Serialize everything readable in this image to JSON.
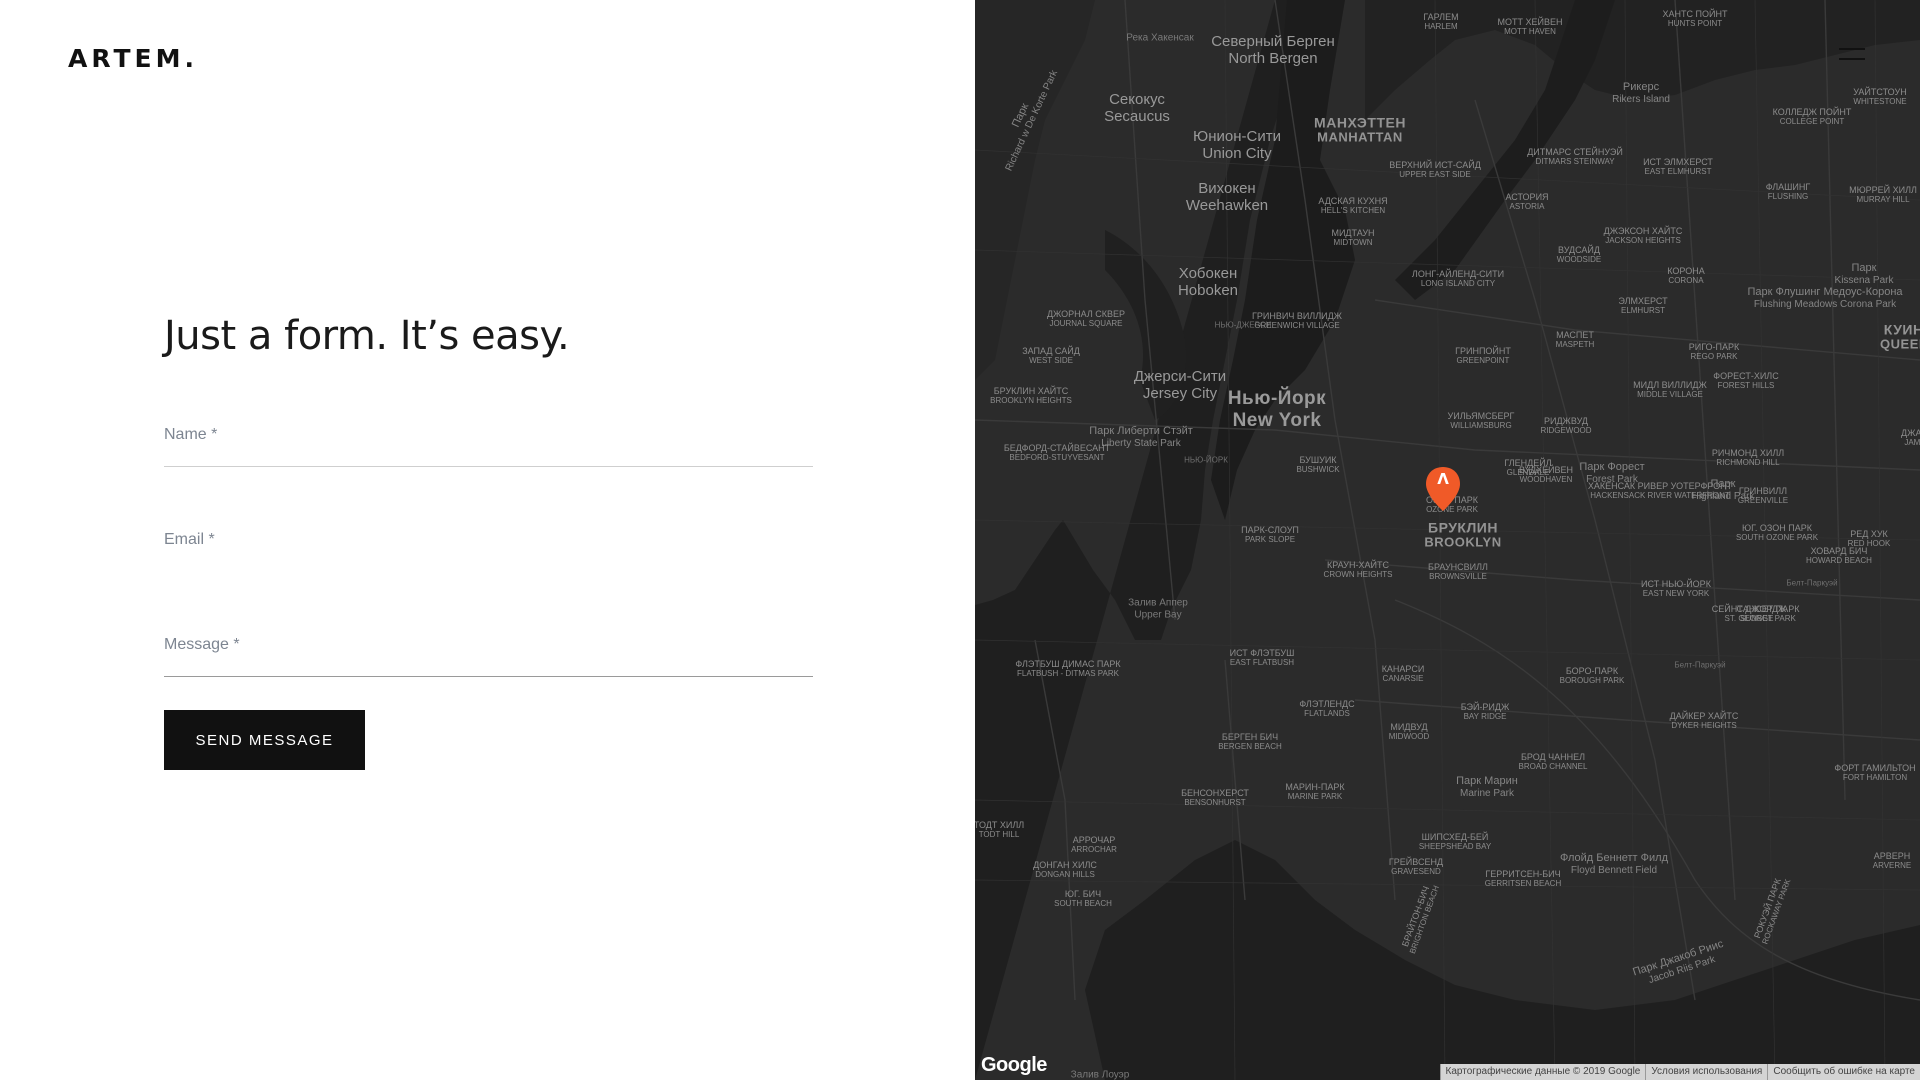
{
  "brand": {
    "logo_text": "ARTEM."
  },
  "form": {
    "heading": "Just a form. It’s easy.",
    "name_label": "Name *",
    "email_label": "Email *",
    "message_label": "Message *",
    "submit_label": "SEND MESSAGE"
  },
  "map": {
    "marker_glyph": "Λ",
    "google_logo": "Google",
    "attribution_data": "Картографические данные © 2019 Google",
    "terms": "Условия использования",
    "report": "Сообщить об ошибке на карте",
    "labels": [
      {
        "ru": "Нью-Йорк",
        "en": "New York",
        "kind": "big"
      },
      {
        "ru": "МАНХЭТТЕН",
        "en": "MANHATTAN",
        "kind": "med"
      },
      {
        "ru": "БРУКЛИН",
        "en": "BROOKLYN",
        "kind": "med"
      },
      {
        "ru": "Джерси-Сити",
        "en": "Jersey City",
        "kind": "city"
      },
      {
        "ru": "Северный Берген",
        "en": "North Bergen",
        "kind": "city"
      },
      {
        "ru": "Юнион-Сити",
        "en": "Union City",
        "kind": "city"
      },
      {
        "ru": "Хобокен",
        "en": "Hoboken",
        "kind": "city"
      },
      {
        "ru": "Вихокен",
        "en": "Weehawken",
        "kind": "city"
      },
      {
        "ru": "Секокус",
        "en": "Secaucus",
        "kind": "city"
      },
      {
        "ru": "Парк Либерти Стэйт",
        "en": "Liberty State Park",
        "kind": "park"
      },
      {
        "ru": "Залив Аппер",
        "en": "Upper Bay",
        "kind": "water"
      },
      {
        "ru": "Залив Лоуэр",
        "en": "",
        "kind": "water"
      },
      {
        "ru": "Река Хакенсак",
        "en": "",
        "kind": "water"
      },
      {
        "ru": "ГАРЛЕМ",
        "en": "HARLEM",
        "kind": "small"
      },
      {
        "ru": "МОТТ ХЕЙВЕН",
        "en": "MOTT HAVEN",
        "kind": "small"
      },
      {
        "ru": "ХАНТС ПОЙНТ",
        "en": "HUNTS POINT",
        "kind": "small"
      },
      {
        "ru": "Рикерс",
        "en": "Rikers Island",
        "kind": "park"
      },
      {
        "ru": "КОЛЛЕДЖ ПОЙНТ",
        "en": "COLLEGE POINT",
        "kind": "small"
      },
      {
        "ru": "УАЙТСТОУН",
        "en": "WHITESTONE",
        "kind": "small"
      },
      {
        "ru": "ВЕРХНИЙ ИСТ-САЙД",
        "en": "UPPER EAST SIDE",
        "kind": "small"
      },
      {
        "ru": "ДИТМАРС СТЕЙНУЭЙ",
        "en": "DITMARS STEINWAY",
        "kind": "small"
      },
      {
        "ru": "ИСТ ЭЛМХЕРСТ",
        "en": "EAST ELMHURST",
        "kind": "small"
      },
      {
        "ru": "ФЛАШИНГ",
        "en": "FLUSHING",
        "kind": "small"
      },
      {
        "ru": "МЮРРЕЙ ХИЛЛ",
        "en": "MURRAY HILL",
        "kind": "small"
      },
      {
        "ru": "АДСКАЯ КУХНЯ",
        "en": "HELL'S KITCHEN",
        "kind": "small"
      },
      {
        "ru": "АСТОРИЯ",
        "en": "ASTORIA",
        "kind": "small"
      },
      {
        "ru": "МИДТАУН",
        "en": "MIDTOWN",
        "kind": "small"
      },
      {
        "ru": "ДЖЭКСОН ХАЙТС",
        "en": "JACKSON HEIGHTS",
        "kind": "small"
      },
      {
        "ru": "ВУДСАЙД",
        "en": "WOODSIDE",
        "kind": "small"
      },
      {
        "ru": "Парк Флушинг Медоус-Корона",
        "en": "Flushing Meadows Corona Park",
        "kind": "park"
      },
      {
        "ru": "Парк",
        "en": "Kissena Park",
        "kind": "park"
      },
      {
        "ru": "ЛОНГ-АЙЛЕНД-СИТИ",
        "en": "LONG ISLAND CITY",
        "kind": "small"
      },
      {
        "ru": "КОРОНА",
        "en": "CORONA",
        "kind": "small"
      },
      {
        "ru": "ЭЛМХЕРСТ",
        "en": "ELMHURST",
        "kind": "small"
      },
      {
        "ru": "ДЖОРНАЛ СКВЕР",
        "en": "JOURNAL SQUARE",
        "kind": "small"
      },
      {
        "ru": "ГРИНВИЧ ВИЛЛИДЖ",
        "en": "GREENWICH VILLAGE",
        "kind": "small"
      },
      {
        "ru": "МАСПЕТ",
        "en": "MASPETH",
        "kind": "small"
      },
      {
        "ru": "ГРИНПОЙНТ",
        "en": "GREENPOINT",
        "kind": "small"
      },
      {
        "ru": "РИГО-ПАРК",
        "en": "REGO PARK",
        "kind": "small"
      },
      {
        "ru": "МИДЛ ВИЛЛИДЖ",
        "en": "MIDDLE VILLAGE",
        "kind": "small"
      },
      {
        "ru": "ФОРЕСТ-ХИЛС",
        "en": "FOREST HILLS",
        "kind": "small"
      },
      {
        "ru": "ЗАПАД САЙД",
        "en": "WEST SIDE",
        "kind": "small"
      },
      {
        "ru": "УИЛЬЯМСБЕРГ",
        "en": "WILLIAMSBURG",
        "kind": "small"
      },
      {
        "ru": "РИДЖВУД",
        "en": "RIDGEWOOD",
        "kind": "small"
      },
      {
        "ru": "ГЛЕНДЕЙЛ",
        "en": "GLENDALE",
        "kind": "small"
      },
      {
        "ru": "Парк Форест",
        "en": "Forest Park",
        "kind": "park"
      },
      {
        "ru": "РИЧМОНД ХИЛЛ",
        "en": "RICHMOND HILL",
        "kind": "small"
      },
      {
        "ru": "ХАКЕНСАК РИВЕР УОТЕРФРОНТ",
        "en": "HACKENSACK RIVER WATERFRONT",
        "kind": "small"
      },
      {
        "ru": "БРУКЛИН ХАЙТС",
        "en": "BROOKLYN HEIGHTS",
        "kind": "small"
      },
      {
        "ru": "БУШУИК",
        "en": "BUSHWICK",
        "kind": "small"
      },
      {
        "ru": "ВУДХЕЙВЕН",
        "en": "WOODHAVEN",
        "kind": "small"
      },
      {
        "ru": "Парк",
        "en": "Highland Park",
        "kind": "park"
      },
      {
        "ru": "ГРИНВИЛЛ",
        "en": "GREENVILLE",
        "kind": "small"
      },
      {
        "ru": "БЕДФОРД-СТАЙВЕСАНТ",
        "en": "BEDFORD-STUYVESANT",
        "kind": "small"
      },
      {
        "ru": "ОЗОН ПАРК",
        "en": "OZONE PARK",
        "kind": "small"
      },
      {
        "ru": "ЮГ. ОЗОН ПАРК",
        "en": "SOUTH OZONE PARK",
        "kind": "small"
      },
      {
        "ru": "РЕД ХУК",
        "en": "RED HOOK",
        "kind": "small"
      },
      {
        "ru": "ПАРК-СЛОУП",
        "en": "PARK SLOPE",
        "kind": "small"
      },
      {
        "ru": "КРАУН-ХАЙТС",
        "en": "CROWN HEIGHTS",
        "kind": "small"
      },
      {
        "ru": "БРАУНСВИЛЛ",
        "en": "BROWNSVILLE",
        "kind": "small"
      },
      {
        "ru": "ИСТ НЬЮ-ЙОРК",
        "en": "EAST NEW YORK",
        "kind": "small"
      },
      {
        "ru": "ХОВАРД БИЧ",
        "en": "HOWARD BEACH",
        "kind": "small"
      },
      {
        "ru": "СЕЙНТ ДЖОРДЖ",
        "en": "ST. GEORGE",
        "kind": "small"
      },
      {
        "ru": "САНСЕТ ПАРК",
        "en": "SUNSET PARK",
        "kind": "small"
      },
      {
        "ru": "ФЛЭТБУШ ДИМАС ПАРК",
        "en": "FLATBUSH - DITMAS PARK",
        "kind": "small"
      },
      {
        "ru": "ИСТ ФЛЭТБУШ",
        "en": "EAST FLATBUSH",
        "kind": "small"
      },
      {
        "ru": "КАНАРСИ",
        "en": "CANARSIE",
        "kind": "small"
      },
      {
        "ru": "БОРО-ПАРК",
        "en": "BOROUGH PARK",
        "kind": "small"
      },
      {
        "ru": "ФЛЭТЛЕНДС",
        "en": "FLATLANDS",
        "kind": "small"
      },
      {
        "ru": "БЭЙ-РИДЖ",
        "en": "BAY RIDGE",
        "kind": "small"
      },
      {
        "ru": "ДАЙКЕР ХАЙТС",
        "en": "DYKER HEIGHTS",
        "kind": "small"
      },
      {
        "ru": "МИДВУД",
        "en": "MIDWOOD",
        "kind": "small"
      },
      {
        "ru": "БЕРГЕН БИЧ",
        "en": "BERGEN BEACH",
        "kind": "small"
      },
      {
        "ru": "БРОД ЧАННЕЛ",
        "en": "BROAD CHANNEL",
        "kind": "small"
      },
      {
        "ru": "ФОРТ ГАМИЛЬТОН",
        "en": "FORT HAMILTON",
        "kind": "small"
      },
      {
        "ru": "БЕНСОНХЕРСТ",
        "en": "BENSONHURST",
        "kind": "small"
      },
      {
        "ru": "МАРИН-ПАРК",
        "en": "MARINE PARK",
        "kind": "small"
      },
      {
        "ru": "Парк Марин",
        "en": "Marine Park",
        "kind": "park"
      },
      {
        "ru": "ТОДТ ХИЛЛ",
        "en": "TODT HILL",
        "kind": "small"
      },
      {
        "ru": "АРРОЧАР",
        "en": "ARROCHAR",
        "kind": "small"
      },
      {
        "ru": "ШИПСХЕД-БЕЙ",
        "en": "SHEEPSHEAD BAY",
        "kind": "small"
      },
      {
        "ru": "Флойд Беннетт Филд",
        "en": "Floyd Bennett Field",
        "kind": "park"
      },
      {
        "ru": "АРВЕРН",
        "en": "ARVERNE",
        "kind": "small"
      },
      {
        "ru": "ДОНГАН ХИЛС",
        "en": "DONGAN HILLS",
        "kind": "small"
      },
      {
        "ru": "ГРЕЙВСЕНД",
        "en": "GRAVESEND",
        "kind": "small"
      },
      {
        "ru": "ГЕРРИТСЕН-БИЧ",
        "en": "GERRITSEN BEACH",
        "kind": "small"
      },
      {
        "ru": "ЮГ. БИЧ",
        "en": "SOUTH BEACH",
        "kind": "small"
      },
      {
        "ru": "РОКУЭЙ ПАРК",
        "en": "ROCKAWAY PARK",
        "kind": "small"
      },
      {
        "ru": "БРАЙТОН-БИЧ",
        "en": "BRIGHTON BEACH",
        "kind": "small"
      },
      {
        "ru": "Парк Джакоб Риис",
        "en": "Jacob Riis Park",
        "kind": "park"
      },
      {
        "ru": "Парк",
        "en": "Richard w De Korte Park",
        "kind": "park"
      },
      {
        "ru": "НЬЮ-ДЖЕРСИ",
        "en": "",
        "kind": "road"
      },
      {
        "ru": "НЬЮ-ЙОРК",
        "en": "",
        "kind": "road"
      },
      {
        "ru": "Белт-Паркуэй",
        "en": "",
        "kind": "road"
      },
      {
        "ru": "Белт-Паркуэй",
        "en": "",
        "kind": "road"
      },
      {
        "ru": "КУИНС",
        "en": "QUEENS",
        "kind": "med"
      },
      {
        "ru": "ДЖАМ",
        "en": "JAMA",
        "kind": "small"
      }
    ]
  }
}
